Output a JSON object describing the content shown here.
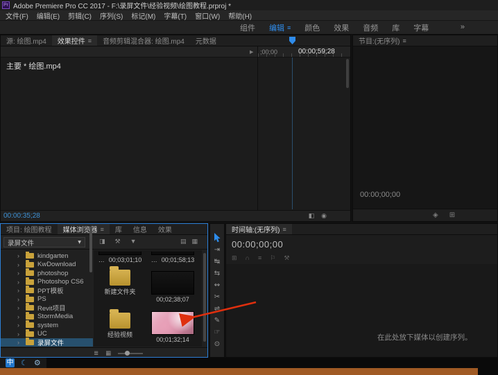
{
  "title_bar": {
    "app": "Pr",
    "title": "Adobe Premiere Pro CC 2017 - F:\\录屏文件\\经验视频\\绘图教程.prproj *"
  },
  "menu_bar": {
    "items": [
      "文件(F)",
      "编辑(E)",
      "剪辑(C)",
      "序列(S)",
      "标记(M)",
      "字幕(T)",
      "窗口(W)",
      "帮助(H)"
    ]
  },
  "workspace_bar": {
    "tabs": [
      "组件",
      "编辑",
      "颜色",
      "效果",
      "音频",
      "库",
      "字幕"
    ],
    "active_tab": "编辑",
    "overflow": "»"
  },
  "icons": {
    "panel_menu": "≡",
    "caret": "▾",
    "expand": "›",
    "ellipsis": "…",
    "ruler_toggle": "▶"
  },
  "effects_panel": {
    "tabs": [
      "源: 绘图.mp4",
      "效果控件",
      "音频剪辑混合器: 绘图.mp4",
      "元数据"
    ],
    "active_tab": "效果控件",
    "clip_label": "主要 * 绘图.mp4",
    "ruler_start": ";00;00",
    "ruler_timecode": "00:00;59;28",
    "current_timecode": "00:00:35;28",
    "footer_icons": [
      {
        "name": "fit",
        "glyph": "◧"
      },
      {
        "name": "zoom",
        "glyph": "◉"
      }
    ]
  },
  "program_panel": {
    "title": "节目:(无序列)",
    "timecode": "00:00;00;00",
    "icons": [
      {
        "name": "export-frame",
        "glyph": "◈"
      },
      {
        "name": "comparison-view",
        "glyph": "⊞"
      }
    ]
  },
  "project_panel": {
    "tabs": [
      "项目: 绘图教程",
      "媒体浏览器",
      "库",
      "信息",
      "效果"
    ],
    "active_tab": "媒体浏览器",
    "directory": "录屏文件",
    "toolbar_left": [
      {
        "name": "view-settings",
        "glyph": "◨"
      },
      {
        "name": "wrench",
        "glyph": "⚒"
      },
      {
        "name": "filter",
        "glyph": "▼"
      }
    ],
    "toolbar_right": [
      {
        "name": "list-view",
        "glyph": "▤"
      },
      {
        "name": "icon-view",
        "glyph": "▦"
      }
    ],
    "tree": [
      "kindgarten",
      "KwDownload",
      "photoshop",
      "Photoshop CS6",
      "PPT模板",
      "PS",
      "Revit项目",
      "StormMedia",
      "system",
      "UC",
      "录屏文件"
    ],
    "selected_tree_item": "录屏文件",
    "grid": {
      "clip_a_duration": "00;03;01;10",
      "clip_b_duration": "00;01;58;13",
      "folder_new": "新建文件夹",
      "clip_c_duration": "00;02;38;07",
      "folder_exp": "经验视频",
      "clip_d_duration": "00;01;32;14"
    },
    "footer_icons": [
      {
        "name": "list-view",
        "glyph": "≣"
      },
      {
        "name": "icon-view",
        "glyph": "▦"
      }
    ]
  },
  "tools": {
    "items": [
      {
        "name": "selection",
        "glyph": ""
      },
      {
        "name": "track-select-forward",
        "glyph": "⇥"
      },
      {
        "name": "ripple-edit",
        "glyph": "↹"
      },
      {
        "name": "rolling-edit",
        "glyph": "⇆"
      },
      {
        "name": "rate-stretch",
        "glyph": "↭"
      },
      {
        "name": "razor",
        "glyph": "✂"
      },
      {
        "name": "slip",
        "glyph": "⇌"
      },
      {
        "name": "pen",
        "glyph": "✎"
      },
      {
        "name": "hand",
        "glyph": "☞"
      },
      {
        "name": "zoom",
        "glyph": "⊙"
      }
    ]
  },
  "timeline_panel": {
    "title": "时间轴:(无序列)",
    "timecode": "00:00;00;00",
    "toolbar": [
      {
        "name": "nest-insert",
        "glyph": "⊞"
      },
      {
        "name": "snap",
        "glyph": "∩"
      },
      {
        "name": "linked-selection",
        "glyph": "≡"
      },
      {
        "name": "add-marker",
        "glyph": "⚐"
      },
      {
        "name": "timeline-settings",
        "glyph": "⚒"
      }
    ],
    "empty_message": "在此处放下媒体以创建序列。"
  },
  "taskbar": {
    "ime": "中",
    "moon": "☾",
    "gear": "⚙"
  }
}
